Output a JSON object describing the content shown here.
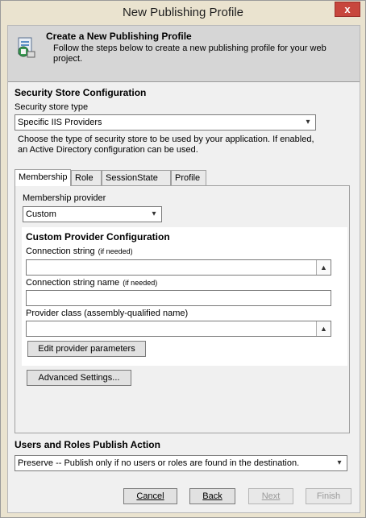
{
  "window": {
    "title": "New Publishing Profile",
    "close_glyph": "x"
  },
  "header": {
    "title": "Create a New Publishing Profile",
    "description": "Follow the steps below to create a new publishing profile for your web project."
  },
  "security_store": {
    "section_title": "Security Store Configuration",
    "type_label": "Security store type",
    "type_value": "Specific IIS Providers",
    "description": "Choose the type of security store to be used by your application. If enabled, an Active Directory configuration can be used."
  },
  "tabs": [
    {
      "label": "Membership",
      "active": true
    },
    {
      "label": "Role",
      "active": false
    },
    {
      "label": "SessionState",
      "active": false
    },
    {
      "label": "Profile",
      "active": false
    }
  ],
  "membership": {
    "provider_label": "Membership provider",
    "provider_value": "Custom",
    "custom_title": "Custom Provider Configuration",
    "conn_label": "Connection string",
    "conn_note": "(if needed)",
    "conn_value": "",
    "conn_name_label": "Connection string name",
    "conn_name_note": "(if needed)",
    "conn_name_value": "",
    "provider_class_label": "Provider class (assembly-qualified name)",
    "provider_class_value": "",
    "edit_params_button": "Edit provider parameters",
    "advanced_button": "Advanced Settings..."
  },
  "publish_action": {
    "section_title": "Users and Roles Publish Action",
    "value": "Preserve -- Publish only if no users or roles are found in the destination."
  },
  "footer": {
    "cancel": "Cancel",
    "back": "Back",
    "next": "Next",
    "finish": "Finish"
  },
  "icons": {
    "dropdown": "chevron-down-icon",
    "updown": "expand-up-icon"
  }
}
